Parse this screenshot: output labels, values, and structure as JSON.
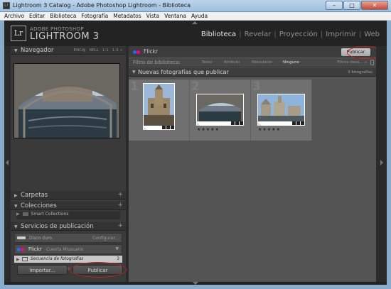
{
  "window": {
    "title": "Lightroom 3 Catalog - Adobe Photoshop Lightroom - Biblioteca",
    "buttons": {
      "minimize": "–",
      "maximize": "□",
      "close": "✕"
    }
  },
  "menu": [
    "Archivo",
    "Editar",
    "Biblioteca",
    "Fotografía",
    "Metadatos",
    "Vista",
    "Ventana",
    "Ayuda"
  ],
  "brand": {
    "logo": "Lr",
    "small": "ADOBE PHOTOSHOP",
    "big": "LIGHTROOM 3"
  },
  "modules": [
    {
      "label": "Biblioteca",
      "active": true
    },
    {
      "label": "Revelar"
    },
    {
      "label": "Proyección"
    },
    {
      "label": "Imprimir"
    },
    {
      "label": "Web"
    }
  ],
  "left_panel": {
    "navigator": {
      "label": "Navegador",
      "options": [
        "ENCAJ",
        "RELL",
        "1:1",
        "1:3 ÷"
      ]
    },
    "carpetas": {
      "label": "Carpetas"
    },
    "colecciones": {
      "label": "Colecciones",
      "items": [
        "Smart Collections"
      ]
    },
    "servicios": {
      "label": "Servicios de publicación",
      "disk": {
        "label": "Disco duro",
        "action": "Configurar..."
      },
      "flickr": {
        "label": "Flickr",
        "account": "Cuenta Miusuario"
      },
      "sequence": {
        "label": "Secuencia de fotografías",
        "count": "3"
      }
    },
    "buttons": {
      "import": "Importar...",
      "publish": "Publicar"
    }
  },
  "center": {
    "service_name": "Flickr",
    "publish_button": "Publicar",
    "filter": {
      "label": "Filtro de biblioteca:",
      "options": [
        "Texto",
        "Atributo",
        "Metadatos",
        "Ninguno"
      ],
      "selected": "Ninguno",
      "status": "Filtros desa... ÷"
    },
    "section": {
      "title": "Nuevas fotografías que publicar",
      "count": "3 fotografías"
    },
    "cells": [
      {
        "num": "1",
        "stars": "★★★★★"
      },
      {
        "num": "2",
        "stars": "★★★★★"
      },
      {
        "num": "3",
        "stars": "★★★★★"
      }
    ]
  },
  "colors": {
    "annotation": "#c0201e",
    "flickr_blue": "#1f6ff0",
    "flickr_pink": "#ff0084"
  }
}
